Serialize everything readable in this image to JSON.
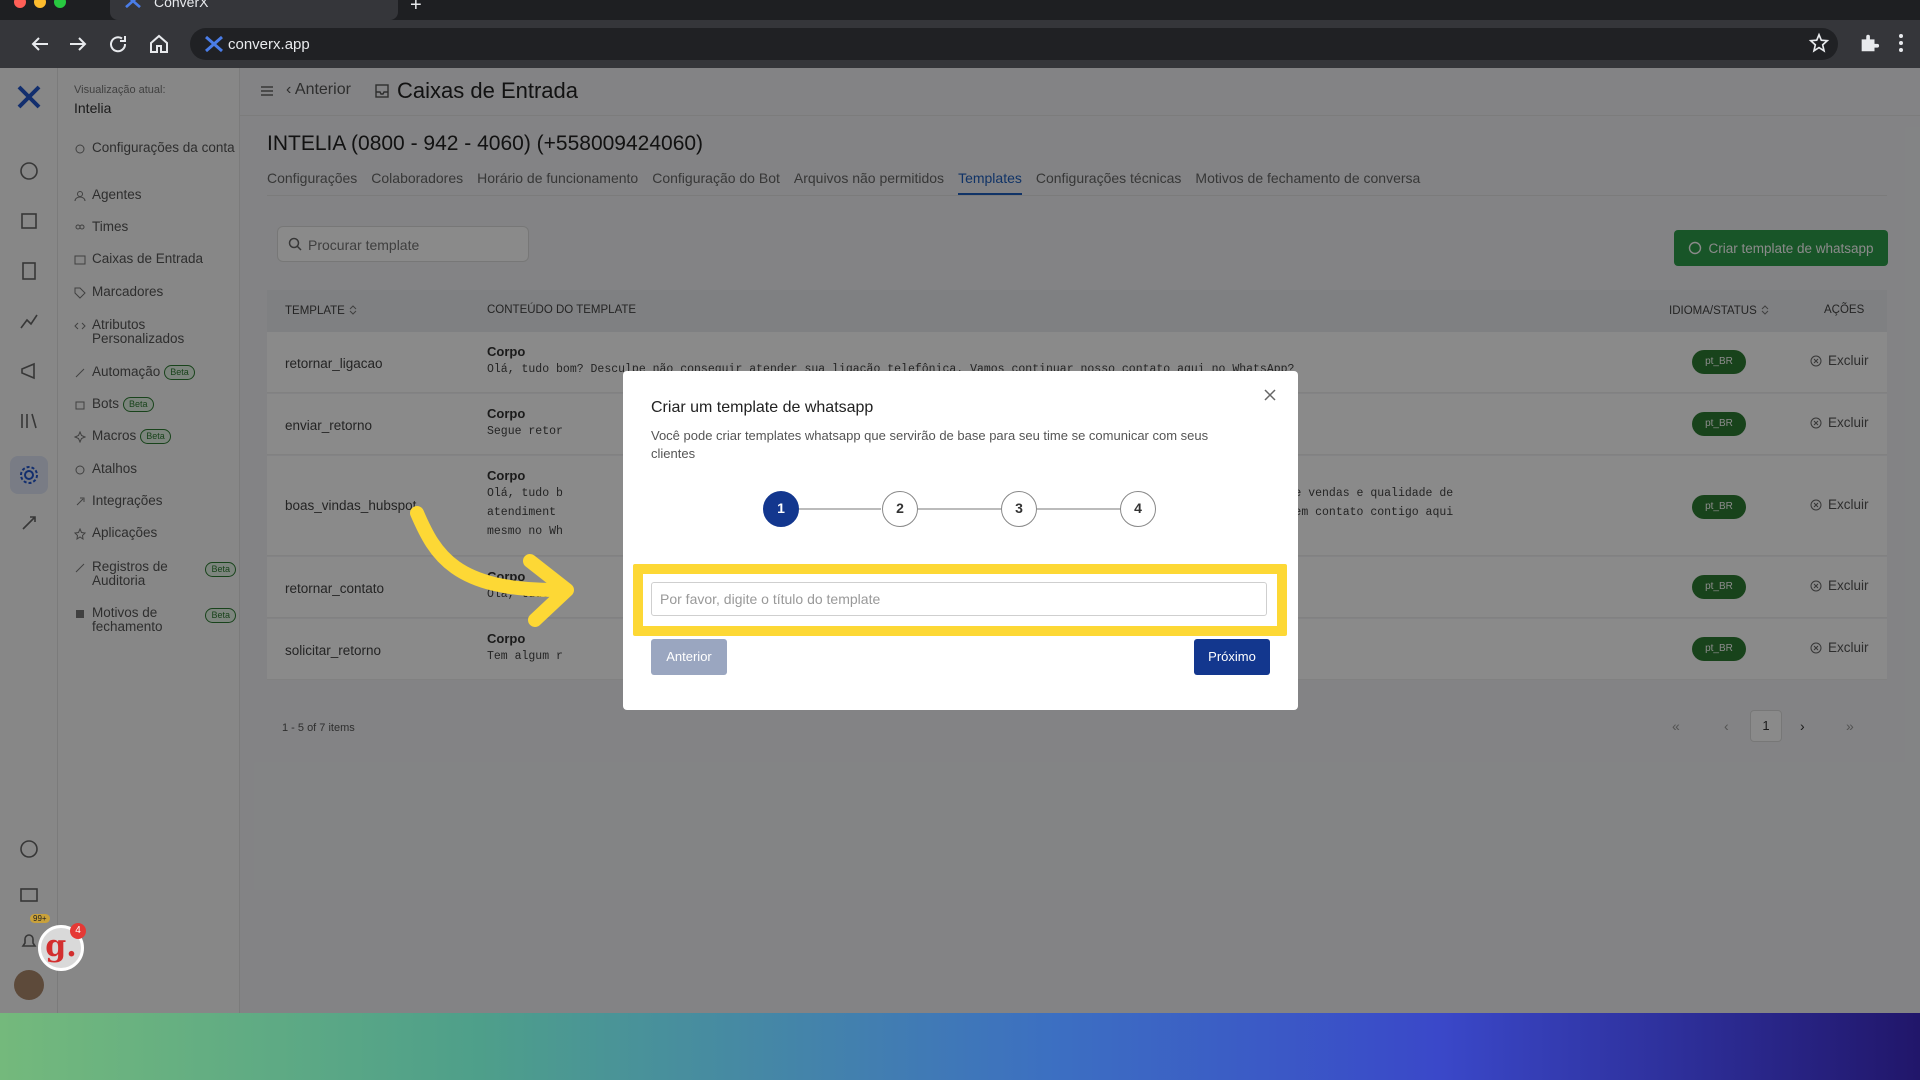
{
  "browser": {
    "tab_title": "ConverX",
    "address": "converx.app"
  },
  "sidebar": {
    "view_label": "Visualização atual:",
    "view_value": "Intelia",
    "items": [
      {
        "label": "Configurações da conta",
        "icon": "settings-icon"
      },
      {
        "label": "Agentes",
        "icon": "users-icon"
      },
      {
        "label": "Times",
        "icon": "team-icon"
      },
      {
        "label": "Caixas de Entrada",
        "icon": "inbox-icon"
      },
      {
        "label": "Marcadores",
        "icon": "tag-icon"
      },
      {
        "label": "Atributos Personalizados",
        "icon": "code-icon"
      },
      {
        "label": "Automação",
        "icon": "automation-icon",
        "badge": "Beta"
      },
      {
        "label": "Bots",
        "icon": "bot-icon",
        "badge": "Beta"
      },
      {
        "label": "Macros",
        "icon": "macro-icon",
        "badge": "Beta"
      },
      {
        "label": "Atalhos",
        "icon": "shortcut-icon"
      },
      {
        "label": "Integrações",
        "icon": "integration-icon"
      },
      {
        "label": "Aplicações",
        "icon": "apps-icon"
      },
      {
        "label": "Registros de Auditoria",
        "icon": "audit-icon",
        "badge": "Beta"
      },
      {
        "label": "Motivos de fechamento",
        "icon": "close-reason-icon",
        "badge": "Beta"
      }
    ]
  },
  "header": {
    "back_label": "Anterior",
    "title": "Caixas de Entrada"
  },
  "inbox": {
    "name": "INTELIA (0800 - 942 - 4060) (+558009424060)",
    "tabs": [
      {
        "label": "Configurações",
        "active": false
      },
      {
        "label": "Colaboradores",
        "active": false
      },
      {
        "label": "Horário de funcionamento",
        "active": false
      },
      {
        "label": "Configuração do Bot",
        "active": false
      },
      {
        "label": "Arquivos não permitidos",
        "active": false
      },
      {
        "label": "Templates",
        "active": true
      },
      {
        "label": "Configurações técnicas",
        "active": false
      },
      {
        "label": "Motivos de fechamento de conversa",
        "active": false
      }
    ]
  },
  "templates": {
    "search_placeholder": "Procurar template",
    "create_button": "Criar template de whatsapp",
    "columns": {
      "template": "Template",
      "content": "Conteúdo do template",
      "language": "Idioma/Status",
      "actions": "Ações"
    },
    "body_label": "Corpo",
    "delete_label": "Excluir",
    "rows": [
      {
        "name": "retornar_ligacao",
        "body": "Olá, tudo bom? Desculpe não conseguir atender sua ligação telefônica. Vamos continuar nosso contato aqui no WhatsApp?",
        "lang": "pt_BR"
      },
      {
        "name": "enviar_retorno",
        "body": "Segue retor",
        "lang": "pt_BR"
      },
      {
        "name": "boas_vindas_hubspot",
        "body": "Olá, tudo b                                                                                      ência, performance de vendas e qualidade de\natendiment                                                                                       e vendas irá entrar em contato contigo aqui\nmesmo no Wh",
        "lang": "pt_BR"
      },
      {
        "name": "retornar_contato",
        "body": "Olá, tudo b",
        "lang": "pt_BR"
      },
      {
        "name": "solicitar_retorno",
        "body": "Tem algum r",
        "lang": "pt_BR"
      }
    ],
    "pagination_info": "1 - 5 of 7 items",
    "current_page": "1"
  },
  "modal": {
    "title": "Criar um template de whatsapp",
    "description": "Você pode criar templates whatsapp que servirão de base para seu time se comunicar com seus clientes",
    "steps": [
      "1",
      "2",
      "3",
      "4"
    ],
    "active_step": 1,
    "input_placeholder": "Por favor, digite o título do template",
    "prev_button": "Anterior",
    "next_button": "Próximo"
  },
  "overlay_badges": {
    "g_label": "g.",
    "g_count": "4",
    "notif_count": "99+"
  },
  "colors": {
    "primary": "#13378e",
    "whatsapp_green": "#2e9e4a",
    "highlight": "#fdd835"
  }
}
